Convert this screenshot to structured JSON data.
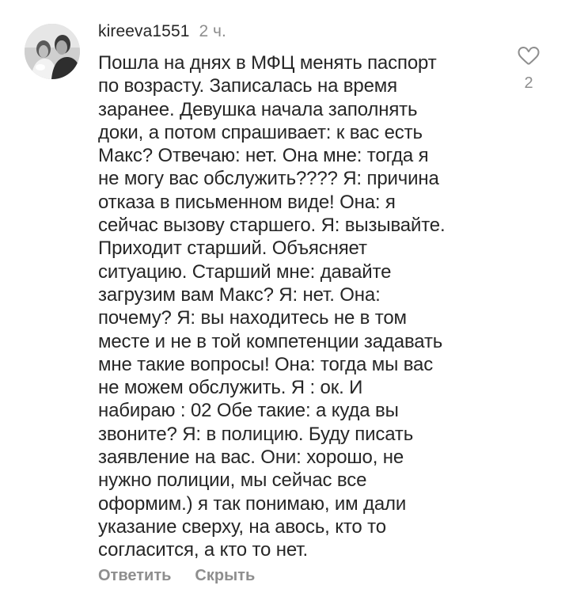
{
  "comment": {
    "avatar_icon": "profile-photo",
    "username": "kireeva1551",
    "timestamp": "2 ч.",
    "text": "Пошла на днях в МФЦ менять паспорт\nпо возрасту. Записалась на время\nзаранее. Девушка начала заполнять\nдоки, а потом спрашивает: к вас есть\nМакс? Отвечаю: нет. Она мне: тогда я\nне могу вас обслужить???? Я: причина\nотказа в письменном виде! Она: я\nсейчас вызову старшего. Я: вызывайте.\nПриходит старший. Объясняет\nситуацию. Старший мне: давайте\nзагрузим вам Макс? Я: нет. Она:\nпочему? Я: вы находитесь не в том\nместе и не в той компетенции задавать\nмне такие вопросы! Она: тогда мы вас\nне можем обслужить. Я : ок. И\nнабираю : 02 Обе такие: а куда вы\nзвоните? Я: в полицию. Буду писать\nзаявление на вас. Они: хорошо, не\nнужно полиции, мы сейчас все\nоформим.) я так понимаю, им дали\nуказание сверху, на авось, кто то\nсогласится, а кто то нет.",
    "like_icon": "heart-outline-icon",
    "like_count": "2",
    "reply_label": "Ответить",
    "hide_label": "Скрыть"
  },
  "colors": {
    "text": "#262626",
    "secondary": "#8e8e8e",
    "background": "#ffffff"
  }
}
